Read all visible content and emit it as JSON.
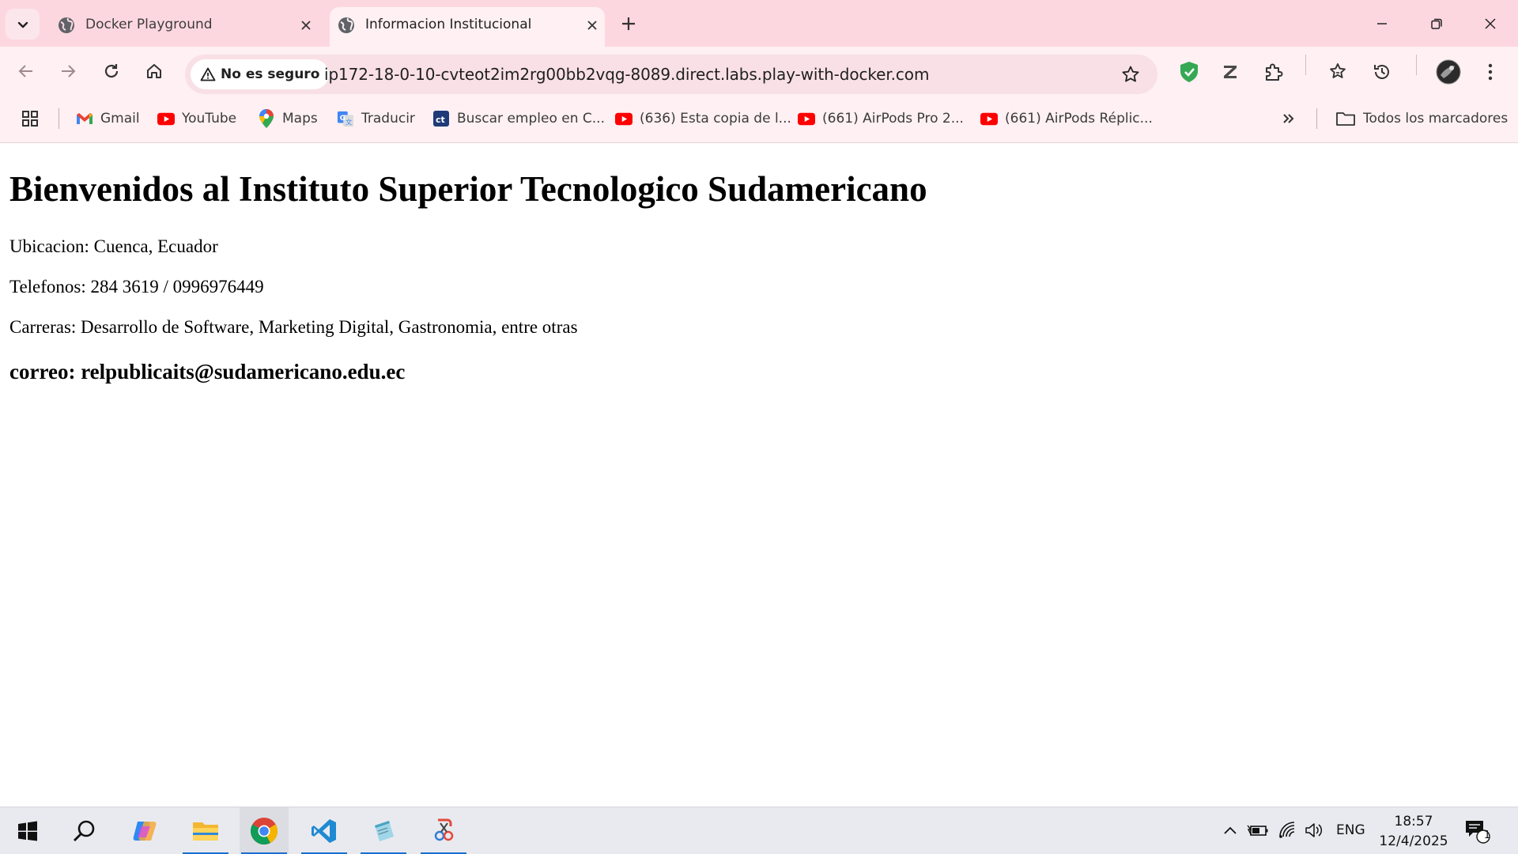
{
  "browser": {
    "tabs": [
      {
        "title": "Docker Playground",
        "active": false,
        "icon": "globe-icon"
      },
      {
        "title": "Informacion Institucional",
        "active": true,
        "icon": "globe-icon"
      }
    ],
    "security_label": "No es seguro",
    "url": "ip172-18-0-10-cvteot2im2rg00bb2vqg-8089.direct.labs.play-with-docker.com",
    "accent_color": "#fdd7e0"
  },
  "bookmarks": {
    "items": [
      {
        "label": "Gmail",
        "icon": "gmail-icon"
      },
      {
        "label": "YouTube",
        "icon": "youtube-icon"
      },
      {
        "label": "Maps",
        "icon": "maps-pin-icon"
      },
      {
        "label": "Traducir",
        "icon": "translate-icon"
      },
      {
        "label": "Buscar empleo en C...",
        "icon": "job-search-icon"
      },
      {
        "label": "(636) Esta copia de l...",
        "icon": "youtube-icon"
      },
      {
        "label": "(661) AirPods Pro 2...",
        "icon": "youtube-icon"
      },
      {
        "label": "(661) AirPods Réplic...",
        "icon": "youtube-icon"
      }
    ],
    "all_bookmarks": "Todos los marcadores"
  },
  "page": {
    "heading": "Bienvenidos al Instituto Superior Tecnologico Sudamericano",
    "location": "Ubicacion: Cuenca, Ecuador",
    "phones": "Telefonos: 284 3619 / 0996976449",
    "careers": "Carreras: Desarrollo de Software, Marketing Digital, Gastronomia, entre otras",
    "email": "correo: relpublicaits@sudamericano.edu.ec"
  },
  "taskbar": {
    "language": "ENG",
    "time": "18:57",
    "date": "12/4/2025",
    "notification_count": "1"
  }
}
